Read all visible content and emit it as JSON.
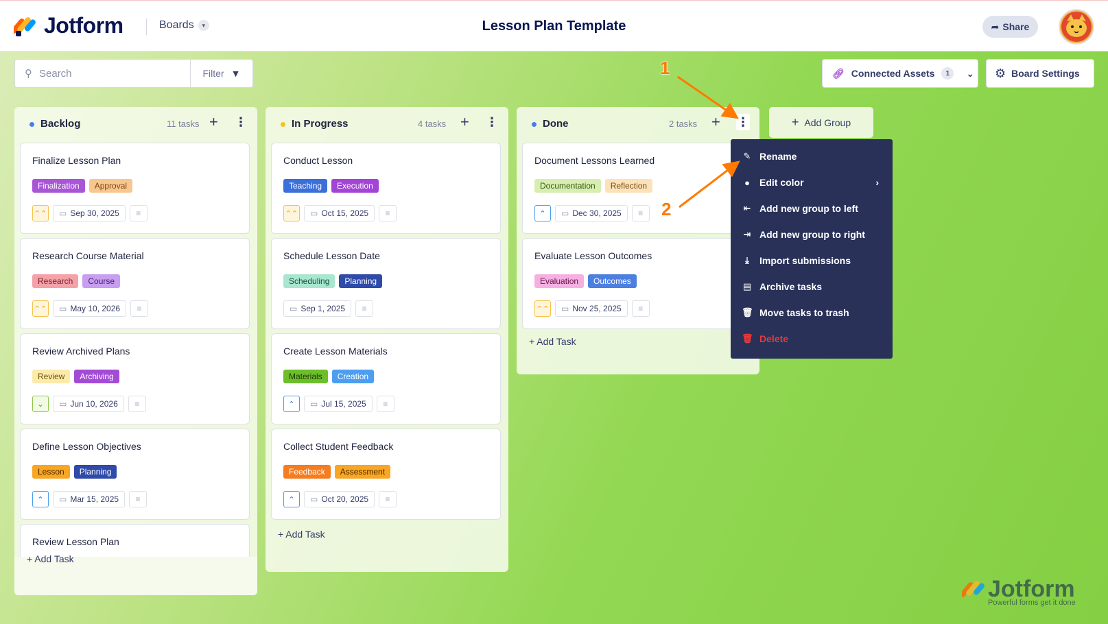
{
  "header": {
    "logo_text": "Jotform",
    "boards_label": "Boards",
    "title": "Lesson Plan Template",
    "share_label": "Share"
  },
  "toolbar": {
    "search_placeholder": "Search",
    "filter_label": "Filter",
    "connected_assets_label": "Connected Assets",
    "connected_assets_count": "1",
    "board_settings_label": "Board Settings"
  },
  "columns": [
    {
      "title": "Backlog",
      "count": "11 tasks",
      "dot_color": "#4a7cf0",
      "add_task": "Add Task",
      "cards": [
        {
          "title": "Finalize Lesson Plan",
          "tags": [
            {
              "label": "Finalization",
              "bg": "#a855d6",
              "fg": "#fff"
            },
            {
              "label": "Approval",
              "bg": "#f8c78f",
              "fg": "#7a4a10"
            }
          ],
          "priority": "high",
          "date": "Sep 30, 2025"
        },
        {
          "title": "Research Course Material",
          "tags": [
            {
              "label": "Research",
              "bg": "#f4a1a8",
              "fg": "#7a1f28"
            },
            {
              "label": "Course",
              "bg": "#c89ef0",
              "fg": "#4a2070"
            }
          ],
          "priority": "high",
          "date": "May 10, 2026"
        },
        {
          "title": "Review Archived Plans",
          "tags": [
            {
              "label": "Review",
              "bg": "#fbeaa8",
              "fg": "#6a5410"
            },
            {
              "label": "Archiving",
              "bg": "#a34bd6",
              "fg": "#fff"
            }
          ],
          "priority": "low",
          "date": "Jun 10, 2026"
        },
        {
          "title": "Define Lesson Objectives",
          "tags": [
            {
              "label": "Lesson",
              "bg": "#f8a623",
              "fg": "#4a2a00"
            },
            {
              "label": "Planning",
              "bg": "#2f4aa8",
              "fg": "#fff"
            }
          ],
          "priority": "medium",
          "date": "Mar 15, 2025"
        },
        {
          "title": "Review Lesson Plan",
          "tags": [],
          "priority": "",
          "date": ""
        }
      ]
    },
    {
      "title": "In Progress",
      "count": "4 tasks",
      "dot_color": "#f5c518",
      "add_task": "Add Task",
      "cards": [
        {
          "title": "Conduct Lesson",
          "tags": [
            {
              "label": "Teaching",
              "bg": "#3b6fd9",
              "fg": "#fff"
            },
            {
              "label": "Execution",
              "bg": "#a244d6",
              "fg": "#fff"
            }
          ],
          "priority": "high",
          "date": "Oct 15, 2025"
        },
        {
          "title": "Schedule Lesson Date",
          "tags": [
            {
              "label": "Scheduling",
              "bg": "#a8e6cf",
              "fg": "#12553a"
            },
            {
              "label": "Planning",
              "bg": "#2f4aa8",
              "fg": "#fff"
            }
          ],
          "priority": "",
          "date": "Sep 1, 2025"
        },
        {
          "title": "Create Lesson Materials",
          "tags": [
            {
              "label": "Materials",
              "bg": "#6cbf2a",
              "fg": "#1c3a05"
            },
            {
              "label": "Creation",
              "bg": "#4d9ef0",
              "fg": "#fff"
            }
          ],
          "priority": "medium",
          "date": "Jul 15, 2025"
        },
        {
          "title": "Collect Student Feedback",
          "tags": [
            {
              "label": "Feedback",
              "bg": "#f57c1f",
              "fg": "#fff"
            },
            {
              "label": "Assessment",
              "bg": "#f8a623",
              "fg": "#4a2a00"
            }
          ],
          "priority": "medium",
          "date": "Oct 20, 2025"
        }
      ]
    },
    {
      "title": "Done",
      "count": "2 tasks",
      "dot_color": "#4a7cf0",
      "add_task": "Add Task",
      "cards": [
        {
          "title": "Document Lessons Learned",
          "tags": [
            {
              "label": "Documentation",
              "bg": "#d6eeb0",
              "fg": "#3a5410"
            },
            {
              "label": "Reflection",
              "bg": "#fbe2b8",
              "fg": "#7a4a10"
            }
          ],
          "priority": "medium",
          "date": "Dec 30, 2025"
        },
        {
          "title": "Evaluate Lesson Outcomes",
          "tags": [
            {
              "label": "Evaluation",
              "bg": "#f5b0e0",
              "fg": "#6a1450"
            },
            {
              "label": "Outcomes",
              "bg": "#4d7fe0",
              "fg": "#fff"
            }
          ],
          "priority": "high",
          "date": "Nov 25, 2025"
        }
      ]
    }
  ],
  "add_group_label": "Add Group",
  "context_menu": [
    {
      "label": "Rename",
      "icon": "edit-icon"
    },
    {
      "label": "Edit color",
      "icon": "droplet-icon"
    },
    {
      "label": "Add new group to left",
      "icon": "insert-left-icon"
    },
    {
      "label": "Add new group to right",
      "icon": "insert-right-icon"
    },
    {
      "label": "Import submissions",
      "icon": "import-icon"
    },
    {
      "label": "Archive tasks",
      "icon": "archive-icon"
    },
    {
      "label": "Move tasks to trash",
      "icon": "trash-icon"
    },
    {
      "label": "Delete",
      "icon": "delete-icon"
    }
  ],
  "annotations": {
    "step1": "1",
    "step2": "2",
    "arrow_color": "#ff7a00"
  },
  "watermark": {
    "text": "Jotform",
    "tagline": "Powerful forms get it done"
  }
}
